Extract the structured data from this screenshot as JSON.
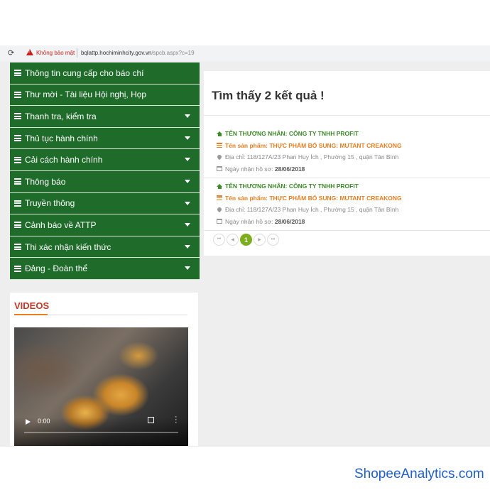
{
  "browser": {
    "security_label": "Không bảo mật",
    "url_host": "bqlattp.hochiminhcity.gov.vn",
    "url_path": "/spcb.aspx?c=19"
  },
  "sidebar": {
    "items": [
      {
        "label": "Thông tin cung cấp cho báo chí",
        "dropdown": false
      },
      {
        "label": "Thư mời - Tài liệu Hội nghị, Họp",
        "dropdown": false
      },
      {
        "label": "Thanh tra, kiểm tra",
        "dropdown": true
      },
      {
        "label": "Thủ tục hành chính",
        "dropdown": true
      },
      {
        "label": "Cải cách hành chính",
        "dropdown": true
      },
      {
        "label": "Thông báo",
        "dropdown": true
      },
      {
        "label": "Truyền thông",
        "dropdown": true
      },
      {
        "label": "Cảnh báo về ATTP",
        "dropdown": true
      },
      {
        "label": "Thi xác nhận kiến thức",
        "dropdown": true
      },
      {
        "label": "Đảng - Đoàn thể",
        "dropdown": true
      }
    ]
  },
  "videos": {
    "title": "VIDEOS",
    "time": "0:00"
  },
  "results": {
    "title": "Tìm thấy 2 kết quả !",
    "entries": [
      {
        "merchant": "TÊN THƯƠNG NHÂN: CÔNG TY TNHH PROFIT",
        "product": "Tên sản phẩm: THỰC PHẨM BỔ SUNG: MUTANT CREAKONG",
        "address": "Địa chỉ: 118/127A/23 Phan Huy Ích , Phường 15 , quận Tân Bình",
        "date_label": "Ngày nhận hồ sơ:",
        "date_value": "28/06/2018"
      },
      {
        "merchant": "TÊN THƯƠNG NHÂN: CÔNG TY TNHH PROFIT",
        "product": "Tên sản phẩm: THỰC PHẨM BỔ SUNG: MUTANT CREAKONG",
        "address": "Địa chỉ: 118/127A/23 Phan Huy Ích , Phường 15 , quận Tân Bình",
        "date_label": "Ngày nhận hồ sơ:",
        "date_value": "28/06/2018"
      }
    ]
  },
  "pagination": {
    "first": "⏮",
    "prev": "◀",
    "current": "1",
    "next": "▶",
    "last": "⏭"
  },
  "watermark": "ShopeeAnalytics.com",
  "colors": {
    "menu_green": "#1e6b2a",
    "merchant_green": "#3c8a28",
    "product_orange": "#e67e22",
    "videos_red": "#c0392b",
    "page_active": "#7cae1c",
    "watermark_blue": "#1f5fc9"
  }
}
